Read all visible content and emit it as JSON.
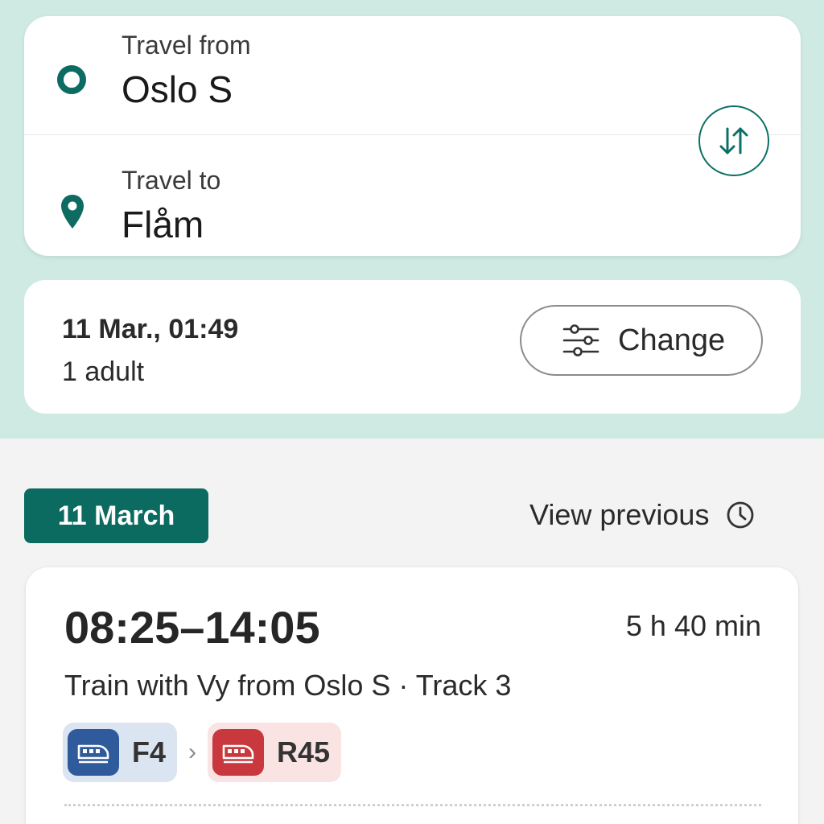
{
  "search": {
    "from_label": "Travel from",
    "from_value": "Oslo S",
    "to_label": "Travel to",
    "to_value": "Flåm",
    "swap_icon": "swap-vertical-icon",
    "origin_icon": "origin-circle-icon",
    "destination_icon": "location-pin-icon"
  },
  "options": {
    "date_time": "11 Mar., 01:49",
    "passengers": "1 adult",
    "change_label": "Change",
    "change_icon": "sliders-icon"
  },
  "results": {
    "date_label": "11 March",
    "view_previous_label": "View previous",
    "view_previous_icon": "clock-icon",
    "trips": [
      {
        "times": "08:25–14:05",
        "duration": "5 h 40 min",
        "description": "Train with Vy from Oslo S · Track 3",
        "legs": [
          {
            "line": "F4",
            "icon": "train-icon",
            "color": "#2f5a9c"
          },
          {
            "line": "R45",
            "icon": "train-icon",
            "color": "#c8383c"
          }
        ],
        "separator": "›"
      }
    ]
  },
  "colors": {
    "accent": "#0b6b60",
    "header_bg": "#cfe9e3",
    "page_bg": "#f3f3f3"
  }
}
